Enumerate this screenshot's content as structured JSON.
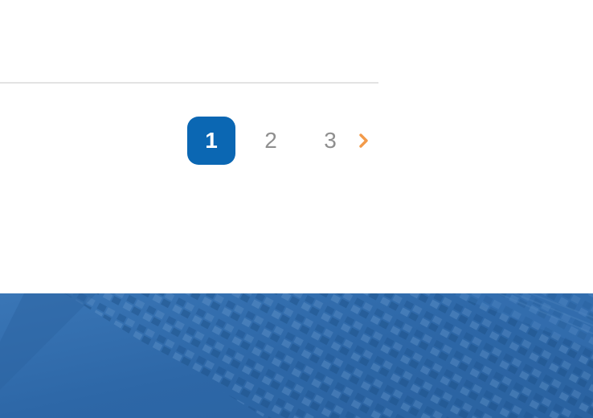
{
  "pagination": {
    "pages": [
      {
        "label": "1",
        "active": true
      },
      {
        "label": "2",
        "active": false
      },
      {
        "label": "3",
        "active": false
      }
    ],
    "next_icon": "chevron-right-icon",
    "active_color": "#0b67b3",
    "next_color": "#f29a4a"
  },
  "footer": {
    "background_color": "#2f6aa9"
  }
}
